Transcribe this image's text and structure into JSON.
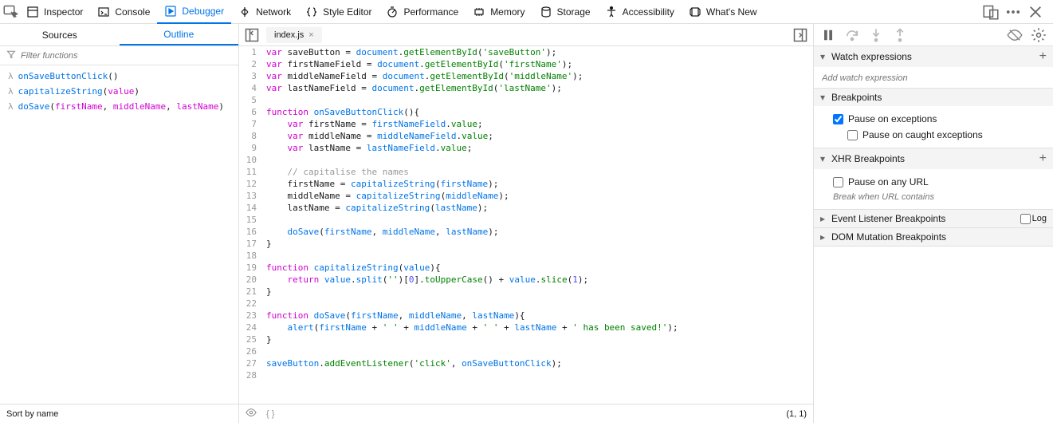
{
  "toolbar": {
    "tabs": [
      {
        "label": "Inspector"
      },
      {
        "label": "Console"
      },
      {
        "label": "Debugger"
      },
      {
        "label": "Network"
      },
      {
        "label": "Style Editor"
      },
      {
        "label": "Performance"
      },
      {
        "label": "Memory"
      },
      {
        "label": "Storage"
      },
      {
        "label": "Accessibility"
      },
      {
        "label": "What's New"
      }
    ],
    "active": 2
  },
  "leftPanel": {
    "tabs": {
      "sources": "Sources",
      "outline": "Outline",
      "active": "outline"
    },
    "filterPlaceholder": "Filter functions",
    "functions": [
      {
        "name": "onSaveButtonClick",
        "params": []
      },
      {
        "name": "capitalizeString",
        "params": [
          "value"
        ]
      },
      {
        "name": "doSave",
        "params": [
          "firstName",
          "middleName",
          "lastName"
        ]
      }
    ],
    "sortLabel": "Sort by name"
  },
  "editor": {
    "fileName": "index.js",
    "cursor": "(1, 1)",
    "lines": [
      {
        "n": 1,
        "t": [
          [
            "kw",
            "var"
          ],
          [
            "op",
            " saveButton "
          ],
          [
            "op",
            "= "
          ],
          [
            "def",
            "document"
          ],
          [
            "op",
            "."
          ],
          [
            "prop",
            "getElementById"
          ],
          [
            "op",
            "("
          ],
          [
            "str",
            "'saveButton'"
          ],
          [
            "op",
            ");"
          ]
        ]
      },
      {
        "n": 2,
        "t": [
          [
            "kw",
            "var"
          ],
          [
            "op",
            " firstNameField "
          ],
          [
            "op",
            "= "
          ],
          [
            "def",
            "document"
          ],
          [
            "op",
            "."
          ],
          [
            "prop",
            "getElementById"
          ],
          [
            "op",
            "("
          ],
          [
            "str",
            "'firstName'"
          ],
          [
            "op",
            ");"
          ]
        ]
      },
      {
        "n": 3,
        "t": [
          [
            "kw",
            "var"
          ],
          [
            "op",
            " middleNameField "
          ],
          [
            "op",
            "= "
          ],
          [
            "def",
            "document"
          ],
          [
            "op",
            "."
          ],
          [
            "prop",
            "getElementById"
          ],
          [
            "op",
            "("
          ],
          [
            "str",
            "'middleName'"
          ],
          [
            "op",
            ");"
          ]
        ]
      },
      {
        "n": 4,
        "t": [
          [
            "kw",
            "var"
          ],
          [
            "op",
            " lastNameField "
          ],
          [
            "op",
            "= "
          ],
          [
            "def",
            "document"
          ],
          [
            "op",
            "."
          ],
          [
            "prop",
            "getElementById"
          ],
          [
            "op",
            "("
          ],
          [
            "str",
            "'lastName'"
          ],
          [
            "op",
            ");"
          ]
        ]
      },
      {
        "n": 5,
        "t": []
      },
      {
        "n": 6,
        "t": [
          [
            "kw",
            "function"
          ],
          [
            "op",
            " "
          ],
          [
            "fn",
            "onSaveButtonClick"
          ],
          [
            "op",
            "(){"
          ]
        ]
      },
      {
        "n": 7,
        "t": [
          [
            "op",
            "    "
          ],
          [
            "kw",
            "var"
          ],
          [
            "op",
            " firstName "
          ],
          [
            "op",
            "= "
          ],
          [
            "def",
            "firstNameField"
          ],
          [
            "op",
            "."
          ],
          [
            "prop",
            "value"
          ],
          [
            "op",
            ";"
          ]
        ]
      },
      {
        "n": 8,
        "t": [
          [
            "op",
            "    "
          ],
          [
            "kw",
            "var"
          ],
          [
            "op",
            " middleName "
          ],
          [
            "op",
            "= "
          ],
          [
            "def",
            "middleNameField"
          ],
          [
            "op",
            "."
          ],
          [
            "prop",
            "value"
          ],
          [
            "op",
            ";"
          ]
        ]
      },
      {
        "n": 9,
        "t": [
          [
            "op",
            "    "
          ],
          [
            "kw",
            "var"
          ],
          [
            "op",
            " lastName "
          ],
          [
            "op",
            "= "
          ],
          [
            "def",
            "lastNameField"
          ],
          [
            "op",
            "."
          ],
          [
            "prop",
            "value"
          ],
          [
            "op",
            ";"
          ]
        ]
      },
      {
        "n": 10,
        "t": []
      },
      {
        "n": 11,
        "t": [
          [
            "op",
            "    "
          ],
          [
            "cmt",
            "// capitalise the names"
          ]
        ]
      },
      {
        "n": 12,
        "t": [
          [
            "op",
            "    firstName "
          ],
          [
            "op",
            "= "
          ],
          [
            "fn",
            "capitalizeString"
          ],
          [
            "op",
            "("
          ],
          [
            "def",
            "firstName"
          ],
          [
            "op",
            ");"
          ]
        ]
      },
      {
        "n": 13,
        "t": [
          [
            "op",
            "    middleName "
          ],
          [
            "op",
            "= "
          ],
          [
            "fn",
            "capitalizeString"
          ],
          [
            "op",
            "("
          ],
          [
            "def",
            "middleName"
          ],
          [
            "op",
            ");"
          ]
        ]
      },
      {
        "n": 14,
        "t": [
          [
            "op",
            "    lastName "
          ],
          [
            "op",
            "= "
          ],
          [
            "fn",
            "capitalizeString"
          ],
          [
            "op",
            "("
          ],
          [
            "def",
            "lastName"
          ],
          [
            "op",
            ");"
          ]
        ]
      },
      {
        "n": 15,
        "t": []
      },
      {
        "n": 16,
        "t": [
          [
            "op",
            "    "
          ],
          [
            "fn",
            "doSave"
          ],
          [
            "op",
            "("
          ],
          [
            "def",
            "firstName"
          ],
          [
            "op",
            ", "
          ],
          [
            "def",
            "middleName"
          ],
          [
            "op",
            ", "
          ],
          [
            "def",
            "lastName"
          ],
          [
            "op",
            ");"
          ]
        ]
      },
      {
        "n": 17,
        "t": [
          [
            "op",
            "}"
          ]
        ]
      },
      {
        "n": 18,
        "t": []
      },
      {
        "n": 19,
        "t": [
          [
            "kw",
            "function"
          ],
          [
            "op",
            " "
          ],
          [
            "fn",
            "capitalizeString"
          ],
          [
            "op",
            "("
          ],
          [
            "def",
            "value"
          ],
          [
            "op",
            "){"
          ]
        ]
      },
      {
        "n": 20,
        "t": [
          [
            "op",
            "    "
          ],
          [
            "kw",
            "return"
          ],
          [
            "op",
            " "
          ],
          [
            "def",
            "value"
          ],
          [
            "op",
            "."
          ],
          [
            "fn",
            "split"
          ],
          [
            "op",
            "("
          ],
          [
            "str",
            "''"
          ],
          [
            "op",
            ")["
          ],
          [
            "num",
            "0"
          ],
          [
            "op",
            "]."
          ],
          [
            "prop",
            "toUpperCase"
          ],
          [
            "op",
            "() + "
          ],
          [
            "def",
            "value"
          ],
          [
            "op",
            "."
          ],
          [
            "prop",
            "slice"
          ],
          [
            "op",
            "("
          ],
          [
            "num",
            "1"
          ],
          [
            "op",
            ");"
          ]
        ]
      },
      {
        "n": 21,
        "t": [
          [
            "op",
            "}"
          ]
        ]
      },
      {
        "n": 22,
        "t": []
      },
      {
        "n": 23,
        "t": [
          [
            "kw",
            "function"
          ],
          [
            "op",
            " "
          ],
          [
            "fn",
            "doSave"
          ],
          [
            "op",
            "("
          ],
          [
            "def",
            "firstName"
          ],
          [
            "op",
            ", "
          ],
          [
            "def",
            "middleName"
          ],
          [
            "op",
            ", "
          ],
          [
            "def",
            "lastName"
          ],
          [
            "op",
            "){"
          ]
        ]
      },
      {
        "n": 24,
        "t": [
          [
            "op",
            "    "
          ],
          [
            "fn",
            "alert"
          ],
          [
            "op",
            "("
          ],
          [
            "def",
            "firstName"
          ],
          [
            "op",
            " + "
          ],
          [
            "str",
            "' '"
          ],
          [
            "op",
            " + "
          ],
          [
            "def",
            "middleName"
          ],
          [
            "op",
            " + "
          ],
          [
            "str",
            "' '"
          ],
          [
            "op",
            " + "
          ],
          [
            "def",
            "lastName"
          ],
          [
            "op",
            " + "
          ],
          [
            "str",
            "' has been saved!'"
          ],
          [
            "op",
            ");"
          ]
        ]
      },
      {
        "n": 25,
        "t": [
          [
            "op",
            "}"
          ]
        ]
      },
      {
        "n": 26,
        "t": []
      },
      {
        "n": 27,
        "t": [
          [
            "def",
            "saveButton"
          ],
          [
            "op",
            "."
          ],
          [
            "prop",
            "addEventListener"
          ],
          [
            "op",
            "("
          ],
          [
            "str",
            "'click'"
          ],
          [
            "op",
            ", "
          ],
          [
            "def",
            "onSaveButtonClick"
          ],
          [
            "op",
            ");"
          ]
        ]
      },
      {
        "n": 28,
        "t": []
      }
    ]
  },
  "rightPanel": {
    "watch": {
      "title": "Watch expressions",
      "placeholder": "Add watch expression"
    },
    "breakpoints": {
      "title": "Breakpoints",
      "pauseExceptions": "Pause on exceptions",
      "pauseCaught": "Pause on caught exceptions"
    },
    "xhr": {
      "title": "XHR Breakpoints",
      "pauseAny": "Pause on any URL",
      "placeholder": "Break when URL contains"
    },
    "eventListener": {
      "title": "Event Listener Breakpoints",
      "log": "Log"
    },
    "domMutation": {
      "title": "DOM Mutation Breakpoints"
    }
  }
}
